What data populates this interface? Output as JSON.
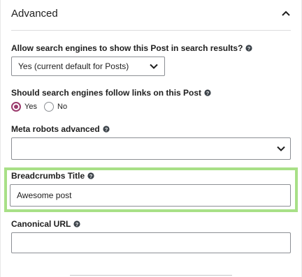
{
  "section": {
    "title": "Advanced",
    "toggle_icon": "chevron-up-icon"
  },
  "show_in_results": {
    "label": "Allow search engines to show this Post in search results?",
    "selected": "Yes (current default for Posts)"
  },
  "follow_links": {
    "label": "Should search engines follow links on this Post",
    "options": [
      "Yes",
      "No"
    ],
    "selected": "Yes"
  },
  "meta_robots": {
    "label": "Meta robots advanced",
    "selected": ""
  },
  "breadcrumbs": {
    "label": "Breadcrumbs Title",
    "value": "Awesome post"
  },
  "canonical": {
    "label": "Canonical URL",
    "value": ""
  },
  "colors": {
    "radio_accent": "#9b3b6d",
    "highlight": "#a8e087"
  }
}
